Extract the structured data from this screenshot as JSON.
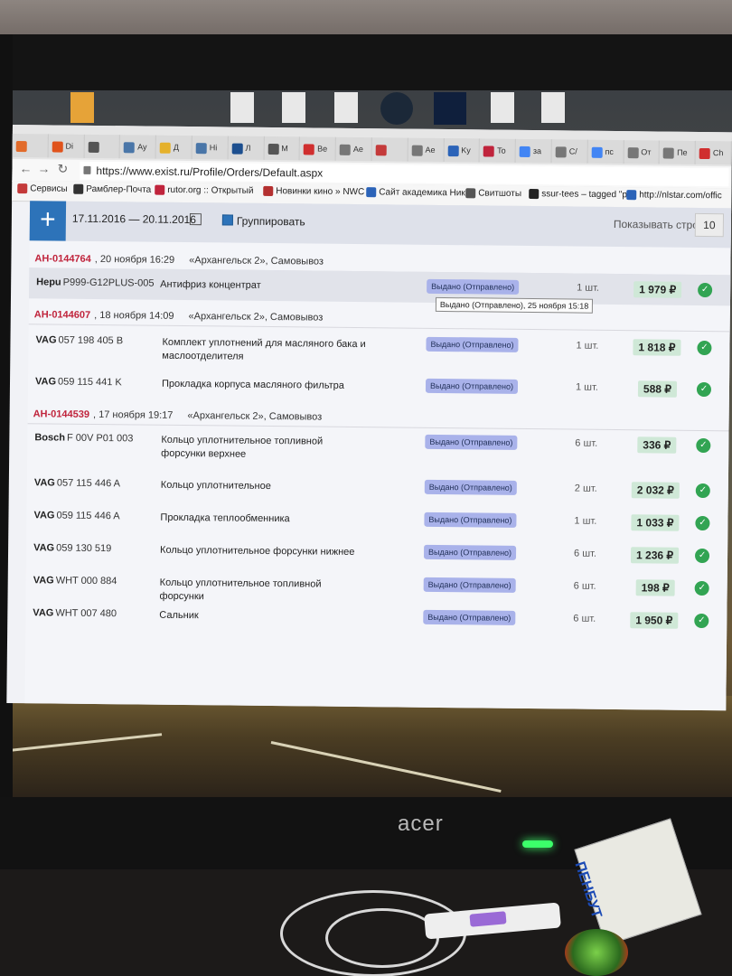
{
  "browser": {
    "tabs": [
      {
        "label": "",
        "color": "#e26b2a"
      },
      {
        "label": "Di",
        "color": "#e0531c"
      },
      {
        "label": "",
        "color": "#555"
      },
      {
        "label": "Ay",
        "color": "#4a76a8"
      },
      {
        "label": "Д",
        "color": "#e5b12b"
      },
      {
        "label": "Hi",
        "color": "#4a76a8"
      },
      {
        "label": "Л",
        "color": "#1d4f8f"
      },
      {
        "label": "M",
        "color": "#555"
      },
      {
        "label": "Be",
        "color": "#d02f2f"
      },
      {
        "label": "Ae",
        "color": "#777"
      },
      {
        "label": "",
        "color": "#c43a3a"
      },
      {
        "label": "Ae",
        "color": "#777"
      },
      {
        "label": "Ky",
        "color": "#2b63b8"
      },
      {
        "label": "To",
        "color": "#c0243c"
      },
      {
        "label": "за",
        "color": "#4285f4"
      },
      {
        "label": "C/",
        "color": "#777"
      },
      {
        "label": "пс",
        "color": "#4285f4"
      },
      {
        "label": "От",
        "color": "#777"
      },
      {
        "label": "Пе",
        "color": "#777"
      },
      {
        "label": "Ch",
        "color": "#d02f2f"
      }
    ],
    "url": "https://www.exist.ru/Profile/Orders/Default.aspx",
    "bookmarks": [
      {
        "label": "Сервисы",
        "color": "#c43a3a"
      },
      {
        "label": "Рамблер-Почта",
        "color": "#333"
      },
      {
        "label": "rutor.org :: Открытый",
        "color": "#c0243c"
      },
      {
        "label": "Новинки кино » NWC",
        "color": "#b43030"
      },
      {
        "label": "Сайт академика Никс",
        "color": "#2b63b8"
      },
      {
        "label": "Свитшоты",
        "color": "#555"
      },
      {
        "label": "ssur-tees – tagged \"p",
        "color": "#222"
      },
      {
        "label": "http://nlstar.com/offic",
        "color": "#2b63b8"
      }
    ]
  },
  "filter": {
    "plus": "+",
    "date_range": "17.11.2016 — 20.11.2016",
    "group_label": "Группировать",
    "rows_label": "Показывать строк",
    "rows_value": "10"
  },
  "orders": [
    {
      "number": "AH-0144764",
      "date": ", 20 ноября 16:29",
      "location": "«Архангельск 2», Самовывоз",
      "items": [
        {
          "brand": "Hepu",
          "code": "P999-G12PLUS-005",
          "desc": "Антифриз концентрат",
          "status": "Выдано (Отправлено)",
          "qty": "1 шт.",
          "price": "1 979 ₽"
        }
      ]
    },
    {
      "number": "AH-0144607",
      "date": ", 18 ноября 14:09",
      "location": "«Архангельск 2», Самовывоз",
      "items": [
        {
          "brand": "VAG",
          "code": "057 198 405 B",
          "desc": "Комплект уплотнений для масляного бака и маслоотделителя",
          "status": "Выдано (Отправлено)",
          "qty": "1 шт.",
          "price": "1 818 ₽"
        },
        {
          "brand": "VAG",
          "code": "059 115 441 K",
          "desc": "Прокладка корпуса масляного фильтра",
          "status": "Выдано (Отправлено)",
          "qty": "1 шт.",
          "price": "588 ₽"
        }
      ]
    },
    {
      "number": "AH-0144539",
      "date": ", 17 ноября 19:17",
      "location": "«Архангельск 2», Самовывоз",
      "items": [
        {
          "brand": "Bosch",
          "code": "F 00V P01 003",
          "desc": "Кольцо уплотнительное топливной форсунки верхнее",
          "status": "Выдано (Отправлено)",
          "qty": "6 шт.",
          "price": "336 ₽"
        },
        {
          "brand": "VAG",
          "code": "057 115 446 A",
          "desc": "Кольцо уплотнительное",
          "status": "Выдано (Отправлено)",
          "qty": "2 шт.",
          "price": "2 032 ₽"
        },
        {
          "brand": "VAG",
          "code": "059 115 446 A",
          "desc": "Прокладка теплообменника",
          "status": "Выдано (Отправлено)",
          "qty": "1 шт.",
          "price": "1 033 ₽"
        },
        {
          "brand": "VAG",
          "code": "059 130 519",
          "desc": "Кольцо уплотнительное форсунки нижнее",
          "status": "Выдано (Отправлено)",
          "qty": "6 шт.",
          "price": "1 236 ₽"
        },
        {
          "brand": "VAG",
          "code": "WHT 000 884",
          "desc": "Кольцо уплотнительное топливной форсунки",
          "status": "Выдано (Отправлено)",
          "qty": "6 шт.",
          "price": "198 ₽"
        },
        {
          "brand": "VAG",
          "code": "WHT 007 480",
          "desc": "Сальник",
          "status": "Выдано (Отправлено)",
          "qty": "6 шт.",
          "price": "1 950 ₽"
        }
      ]
    }
  ],
  "tooltip": "Выдано (Отправлено), 25 ноября 15:18",
  "monitor_brand": "acer",
  "box_label": "ПЕНБУТ"
}
